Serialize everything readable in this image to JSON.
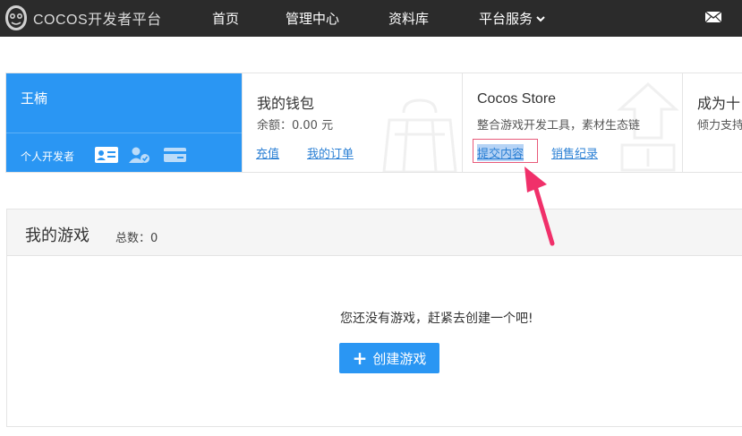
{
  "topbar": {
    "logo_text": "COCOS开发者平台",
    "nav": [
      {
        "label": "首页"
      },
      {
        "label": "管理中心"
      },
      {
        "label": "资料库"
      },
      {
        "label": "平台服务"
      }
    ]
  },
  "profile": {
    "name": "王楠",
    "role": "个人开发者",
    "icons": [
      "id-card-icon",
      "verified-user-icon",
      "credit-card-icon"
    ]
  },
  "wallet": {
    "title": "我的钱包",
    "balance": "余额：0.00 元",
    "links": [
      "充值",
      "我的订单"
    ]
  },
  "store": {
    "title": "Cocos Store",
    "desc": "整合游戏开发工具，素材生态链",
    "links": [
      "提交内容",
      "销售纪录"
    ]
  },
  "partner": {
    "title": "成为十",
    "desc": "倾力支持"
  },
  "games": {
    "title": "我的游戏",
    "count": "总数：0",
    "empty_message": "您还没有游戏，赶紧去创建一个吧!",
    "create_label": "创建游戏"
  },
  "colors": {
    "topbar_bg": "#2b2b2b",
    "accent_blue": "#2a96f3",
    "link_blue": "#2a7fd4",
    "annotation_pink": "#f0306a"
  }
}
